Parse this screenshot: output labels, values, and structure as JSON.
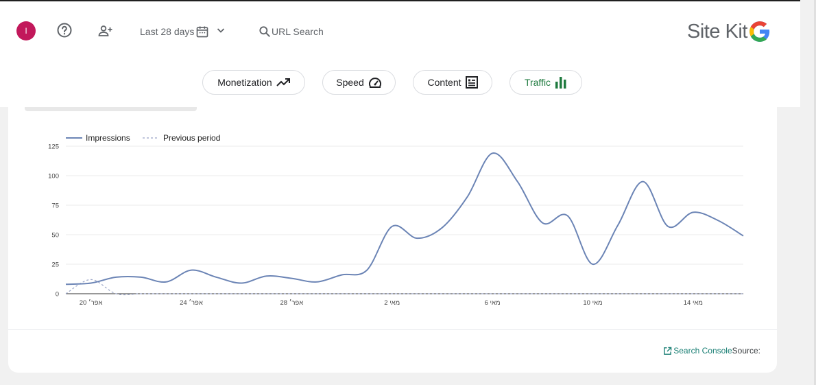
{
  "header": {
    "avatar_initial": "I",
    "date_range": "Last 28 days",
    "url_search": "URL Search",
    "logo_text": "Site Kit",
    "icons": [
      "help-icon",
      "add-user-icon",
      "calendar-icon",
      "chevron-down-icon",
      "search-icon",
      "google-g-logo"
    ]
  },
  "nav_chips": [
    {
      "label": "Monetization",
      "icon": "trending-up-icon"
    },
    {
      "label": "Speed",
      "icon": "speedometer-icon"
    },
    {
      "label": "Content",
      "icon": "article-icon"
    },
    {
      "label": "Traffic",
      "icon": "bar-chart-icon",
      "active": true,
      "color": "#1e7a3e"
    }
  ],
  "card": {
    "source_label": "Source:",
    "source_link": "Search Console"
  },
  "colors": {
    "accent": "#1e7a3e",
    "avatar": "#c2185b",
    "line": "#6b84b5",
    "previous": "#9aa5c7"
  },
  "chart_data": {
    "type": "line",
    "legend": [
      "Impressions",
      "Previous period"
    ],
    "legend_placement": "top-left",
    "grid": true,
    "ylim": [
      0,
      125
    ],
    "yticks": [
      0,
      25,
      50,
      75,
      100,
      125
    ],
    "xticks": [
      "20 אפר׳",
      "24 אפר׳",
      "28 אפר׳",
      "2 מאי",
      "6 מאי",
      "10 מאי",
      "14 מאי"
    ],
    "xtick_index": [
      1,
      5,
      9,
      13,
      17,
      21,
      25
    ],
    "series": [
      {
        "name": "Impressions",
        "values": [
          8,
          9,
          14,
          14,
          10,
          20,
          14,
          9,
          15,
          13,
          10,
          16,
          20,
          57,
          47,
          56,
          82,
          119,
          95,
          60,
          66,
          25,
          58,
          95,
          57,
          69,
          62,
          49
        ]
      },
      {
        "name": "Previous period",
        "values": [
          0,
          12,
          0,
          0,
          0,
          0,
          0,
          0,
          0,
          0,
          0,
          0,
          0,
          0,
          0,
          0,
          0,
          0,
          0,
          0,
          0,
          0,
          0,
          0,
          0,
          0,
          0,
          0
        ]
      }
    ]
  }
}
